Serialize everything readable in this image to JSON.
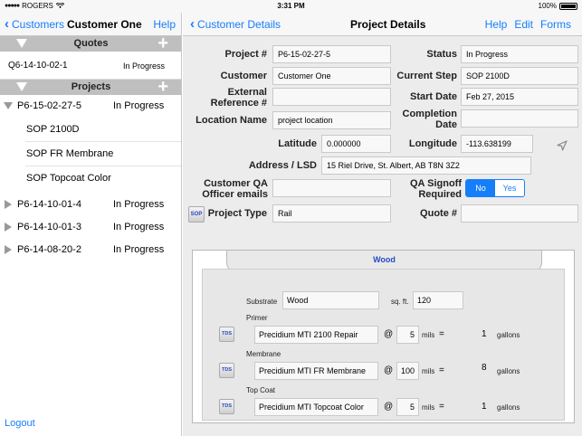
{
  "status_bar": {
    "carrier": "ROGERS",
    "time": "3:31 PM",
    "battery": "100%",
    "battery_level": 1.0
  },
  "left_nav": {
    "back_label": "Customers",
    "title": "Customer One",
    "help": "Help"
  },
  "quotes_section": {
    "title": "Quotes",
    "items": [
      {
        "id": "Q6-14-10-02-1",
        "status": "In Progress"
      }
    ]
  },
  "projects_section": {
    "title": "Projects",
    "items": [
      {
        "id": "P6-15-02-27-5",
        "status": "In Progress",
        "expanded": true,
        "children": [
          "SOP 2100D",
          "SOP FR Membrane",
          "SOP  Topcoat Color"
        ]
      },
      {
        "id": "P6-14-10-01-4",
        "status": "In Progress"
      },
      {
        "id": "P6-14-10-01-3",
        "status": "In Progress"
      },
      {
        "id": "P6-14-08-20-2",
        "status": "In Progress"
      }
    ]
  },
  "logout": "Logout",
  "right_nav": {
    "back_label": "Customer Details",
    "title": "Project Details",
    "help": "Help",
    "edit": "Edit",
    "forms": "Forms"
  },
  "form": {
    "project_no_label": "Project #",
    "project_no": "P6-15-02-27-5",
    "status_label": "Status",
    "status": "In Progress",
    "customer_label": "Customer",
    "customer": "Customer One",
    "current_step_label": "Current Step",
    "current_step": "SOP 2100D",
    "external_ref_label": "External Reference #",
    "external_ref": "",
    "start_date_label": "Start Date",
    "start_date": "Feb 27, 2015",
    "location_label": "Location Name",
    "location": "project location",
    "completion_label": "Completion Date",
    "completion": "",
    "latitude_label": "Latitude",
    "latitude": "0.000000",
    "longitude_label": "Longitude",
    "longitude": "-113.638199",
    "address_label": "Address / LSD",
    "address": "15 Riel Drive, St. Albert, AB T8N 3Z2",
    "qa_emails_label": "Customer QA Officer emails",
    "qa_emails": "",
    "qa_signoff_label": "QA Signoff Required",
    "qa_no": "No",
    "qa_yes": "Yes",
    "qa_selected": "No",
    "sop_button": "SOP",
    "project_type_label": "Project Type",
    "project_type": "Rail",
    "quote_no_label": "Quote #",
    "quote_no": ""
  },
  "wood": {
    "title": "Wood",
    "substrate_label": "Substrate",
    "substrate": "Wood",
    "sqft_label": "sq. ft.",
    "sqft": "120",
    "tds_button": "TDS",
    "layers": [
      {
        "label": "Primer",
        "product": "Precidium MTI 2100 Repair",
        "at": "@",
        "mils": "5",
        "mils_label": "mils",
        "eq": "=",
        "gallons": "1",
        "gallons_label": "gallons"
      },
      {
        "label": "Membrane",
        "product": "Precidium MTI FR  Membrane",
        "at": "@",
        "mils": "100",
        "mils_label": "mils",
        "eq": "=",
        "gallons": "8",
        "gallons_label": "gallons"
      },
      {
        "label": "Top Coat",
        "product": "Precidium MTI Topcoat Color",
        "at": "@",
        "mils": "5",
        "mils_label": "mils",
        "eq": "=",
        "gallons": "1",
        "gallons_label": "gallons"
      }
    ]
  },
  "colors": {
    "accent": "#157efb",
    "section_header": "#bfbfbf",
    "pane_bg": "#ececec",
    "tds_text": "#2549c4"
  }
}
